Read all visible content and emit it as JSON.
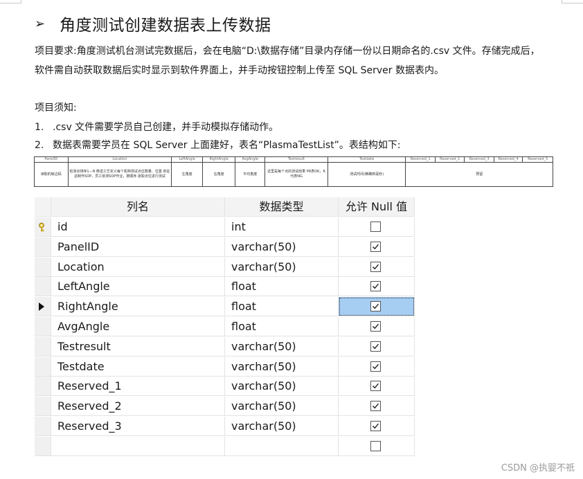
{
  "heading": {
    "bullet": "➢",
    "title": "角度测试创建数据表上传数据"
  },
  "body": {
    "requirement": "项目要求:角度测试机台测试完数据后，会在电脑“D:\\数据存储”目录内存储一份以日期命名的.csv 文件。存储完成后，软件需自动获取数据后实时显示到软件界面上，并手动按钮控制上传至 SQL Server 数据表内。",
    "notes_title": "项目须知:",
    "items": [
      {
        "num": "1.",
        "text": ".csv 文件需要学员自己创建，并手动模拟存储动作。"
      },
      {
        "num": "2.",
        "text": "数据表需要学员在 SQL Server 上面建好，表名“PlasmaTestList”。表结构如下:"
      }
    ]
  },
  "struct_table": {
    "headers": [
      "PanelID",
      "Location",
      "LeftAngle",
      "RightAngle",
      "AvgAngle",
      "Testresult",
      "Testdate",
      "Reserved_1",
      "Reserved_2",
      "Reserved_3",
      "Reserved_4",
      "Reserved_5"
    ],
    "row": {
      "panelid": "读取的板边码",
      "location": "检测点排序1—N 移送工艺定义每个机种测试点位数量、位置 依征这制作SOP，员工依测SOP作业，按顺序 逐取点位进行测试",
      "leftangle": "左角度",
      "rightangle": "右角度",
      "avgangle": "平均角度",
      "testresult": "这里是每个点的测试结果 PR表OK，R代表NG",
      "testdate": "测试时间(精确到毫秒)",
      "reserved": "预留"
    }
  },
  "design_grid": {
    "headers": {
      "name": "列名",
      "type": "数据类型",
      "nullable": "允许 Null 值"
    },
    "rows": [
      {
        "name": "id",
        "type": "int",
        "nullable": false,
        "primary_key": true
      },
      {
        "name": "PanelID",
        "type": "varchar(50)",
        "nullable": true
      },
      {
        "name": "Location",
        "type": "varchar(50)",
        "nullable": true
      },
      {
        "name": "LeftAngle",
        "type": "float",
        "nullable": true
      },
      {
        "name": "RightAngle",
        "type": "float",
        "nullable": true,
        "current": true
      },
      {
        "name": "AvgAngle",
        "type": "float",
        "nullable": true
      },
      {
        "name": "Testresult",
        "type": "varchar(50)",
        "nullable": true
      },
      {
        "name": "Testdate",
        "type": "varchar(50)",
        "nullable": true
      },
      {
        "name": "Reserved_1",
        "type": "varchar(50)",
        "nullable": true
      },
      {
        "name": "Reserved_2",
        "type": "varchar(50)",
        "nullable": true
      },
      {
        "name": "Reserved_3",
        "type": "varchar(50)",
        "nullable": true
      },
      {
        "name": "",
        "type": "",
        "nullable": false
      }
    ],
    "selected_cell_color": "#a6cdf2"
  },
  "watermark": "CSDN @执婴不祇"
}
